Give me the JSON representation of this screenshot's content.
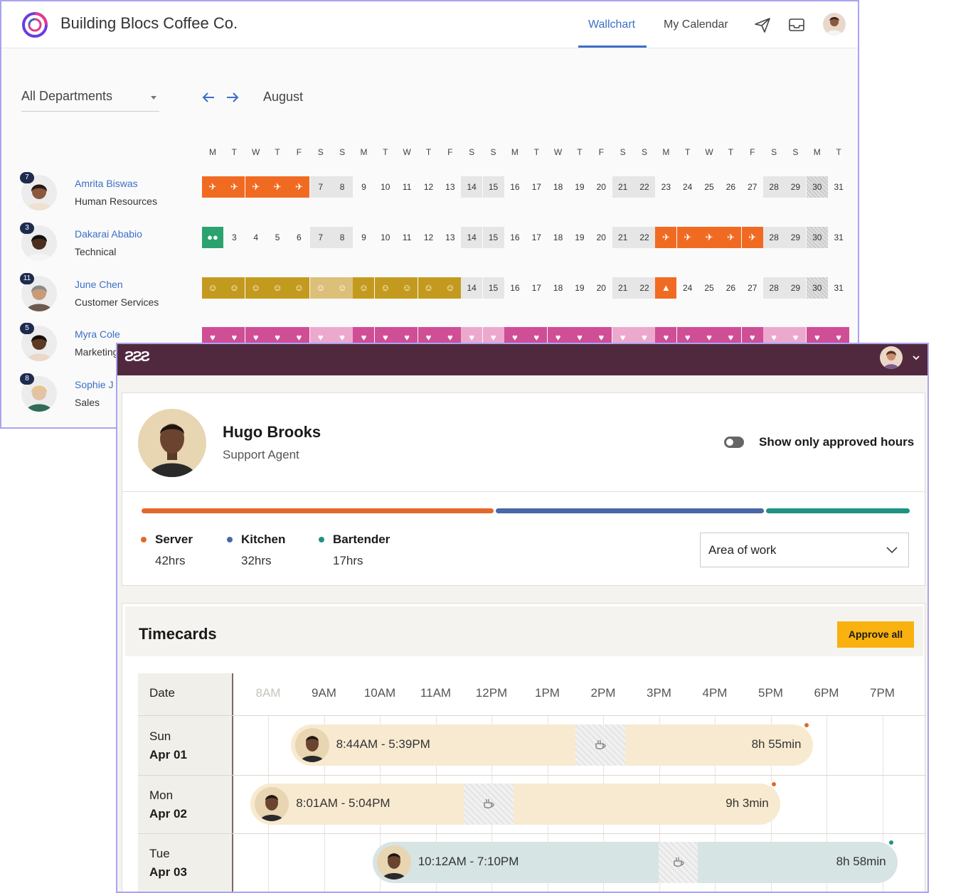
{
  "wallchart": {
    "company": "Building Blocs Coffee Co.",
    "tabs": [
      "Wallchart",
      "My Calendar"
    ],
    "active_tab": "Wallchart",
    "department_filter": "All Departments",
    "month": "August",
    "day_letters": [
      "M",
      "T",
      "W",
      "T",
      "F",
      "S",
      "S",
      "M",
      "T",
      "W",
      "T",
      "F",
      "S",
      "S",
      "M",
      "T",
      "W",
      "T",
      "F",
      "S",
      "S",
      "M",
      "T",
      "W",
      "T",
      "F",
      "S",
      "S",
      "M",
      "T"
    ],
    "people": [
      {
        "name": "Amrita Biswas",
        "dept": "Human Resources",
        "badge": "7"
      },
      {
        "name": "Dakarai Ababio",
        "dept": "Technical",
        "badge": "3"
      },
      {
        "name": "June Chen",
        "dept": "Customer Services",
        "badge": "11"
      },
      {
        "name": "Myra Cole",
        "dept": "Marketing",
        "badge": "5"
      },
      {
        "name": "Sophie J",
        "dept": "Sales",
        "badge": "8"
      }
    ],
    "row_days": [
      [
        "",
        "",
        "",
        "",
        "",
        "7",
        "8",
        "9",
        "10",
        "11",
        "12",
        "13",
        "14",
        "15",
        "16",
        "17",
        "18",
        "19",
        "20",
        "21",
        "22",
        "23",
        "24",
        "25",
        "26",
        "27",
        "28",
        "29",
        "30",
        "31"
      ],
      [
        "",
        "3",
        "4",
        "5",
        "6",
        "7",
        "8",
        "9",
        "10",
        "11",
        "12",
        "13",
        "14",
        "15",
        "16",
        "17",
        "18",
        "19",
        "20",
        "21",
        "22",
        "",
        "",
        "",
        "",
        "",
        "28",
        "29",
        "30",
        "31"
      ],
      [
        "",
        "",
        "",
        "",
        "",
        "",
        "",
        "",
        "",
        "",
        "",
        "",
        "14",
        "15",
        "16",
        "17",
        "18",
        "19",
        "20",
        "21",
        "22",
        "",
        "24",
        "25",
        "26",
        "27",
        "28",
        "29",
        "30",
        "31"
      ],
      [
        "",
        "",
        "",
        "",
        "",
        "",
        "",
        "",
        "",
        "",
        "",
        "",
        "",
        "",
        "",
        "",
        "",
        "",
        "",
        "",
        "",
        "",
        "",
        "",
        "",
        "",
        "",
        "",
        "",
        ""
      ]
    ],
    "colors": {
      "accent": "#3b6fc8",
      "vacation": "#f16a22",
      "team": "#2ba36f",
      "sick": "#c49a1e",
      "parental": "#cf4e95"
    }
  },
  "timesheet": {
    "employee_name": "Hugo Brooks",
    "employee_role": "Support Agent",
    "toggle_label": "Show only approved hours",
    "toggle_on": false,
    "roles": [
      {
        "name": "Server",
        "hours": "42hrs",
        "color": "#e2692b",
        "hours_value": 42
      },
      {
        "name": "Kitchen",
        "hours": "32hrs",
        "color": "#4a67a8",
        "hours_value": 32
      },
      {
        "name": "Bartender",
        "hours": "17hrs",
        "color": "#1f9284",
        "hours_value": 17
      }
    ],
    "area_select": "Area of work",
    "timecards_title": "Timecards",
    "approve_all": "Approve all",
    "date_header": "Date",
    "hours": [
      "8AM",
      "9AM",
      "10AM",
      "11AM",
      "12PM",
      "1PM",
      "2PM",
      "3PM",
      "4PM",
      "5PM",
      "6PM",
      "7PM"
    ],
    "shifts": [
      {
        "day": "Sun",
        "date": "Apr 01",
        "time": "8:44AM - 5:39PM",
        "duration": "8h 55min",
        "status_color": "#e2692b",
        "bar_color": "#f8ead0"
      },
      {
        "day": "Mon",
        "date": "Apr 02",
        "time": "8:01AM - 5:04PM",
        "duration": "9h 3min",
        "status_color": "#e2692b",
        "bar_color": "#f8ead0"
      },
      {
        "day": "Tue",
        "date": "Apr 03",
        "time": "10:12AM - 7:10PM",
        "duration": "8h 58min",
        "status_color": "#1f9284",
        "bar_color": "#d6e4e3"
      }
    ]
  }
}
